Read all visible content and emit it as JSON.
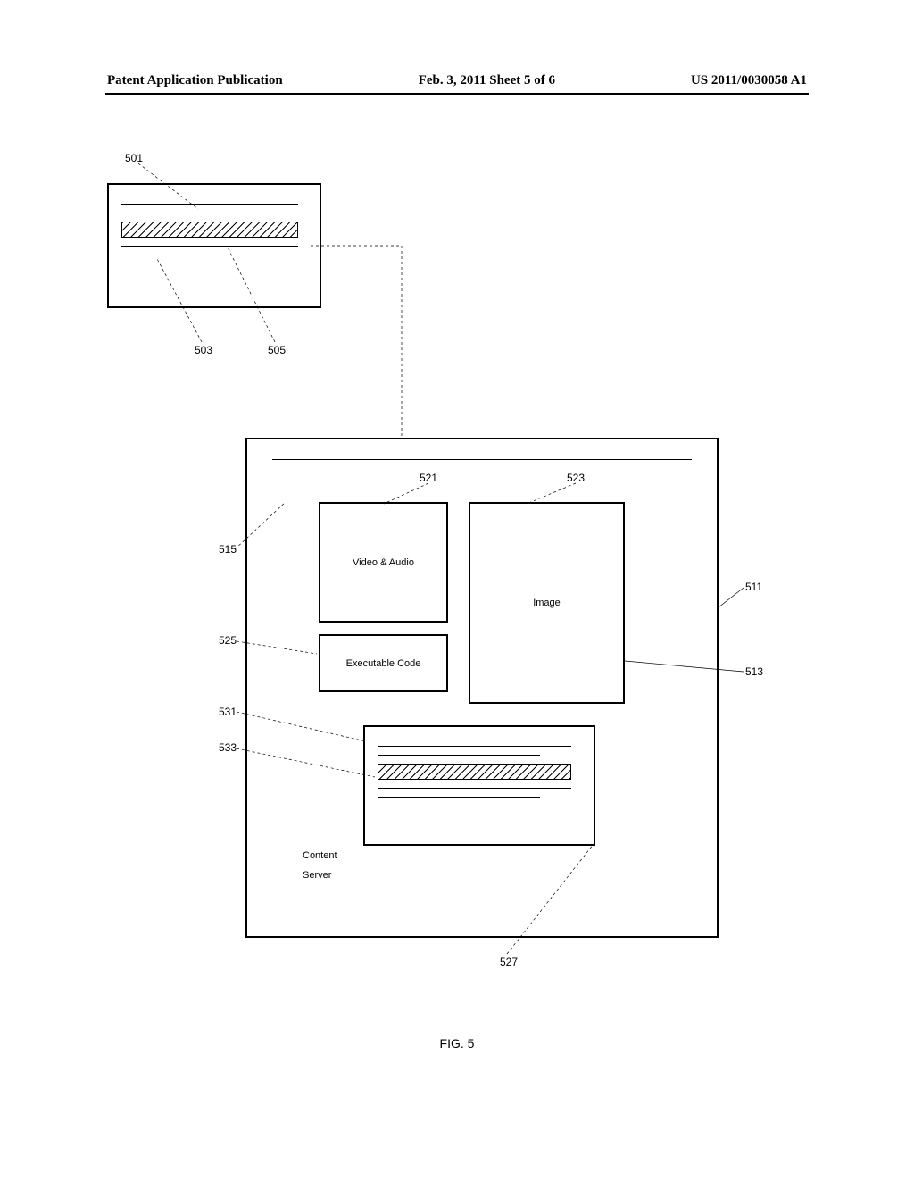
{
  "header": {
    "left": "Patent Application Publication",
    "center": "Feb. 3, 2011  Sheet 5 of 6",
    "right": "US 2011/0030058 A1"
  },
  "figure_caption": "FIG. 5",
  "labels": {
    "l501": "501",
    "l503": "503",
    "l505": "505",
    "l515": "515",
    "l521": "521",
    "l523": "523",
    "l525": "525",
    "l531": "531",
    "l533": "533",
    "l511": "511",
    "l513": "513",
    "l527": "527"
  },
  "boxes": {
    "video_audio": "Video & Audio",
    "executable": "Executable Code",
    "image": "Image",
    "content": "Content",
    "server": "Server"
  }
}
